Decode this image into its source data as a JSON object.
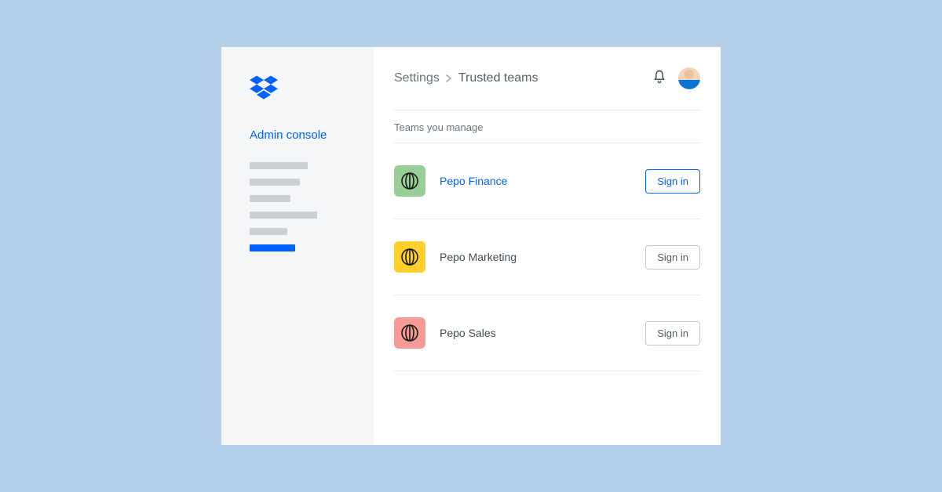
{
  "sidebar": {
    "title": "Admin console"
  },
  "breadcrumb": {
    "parent": "Settings",
    "current": "Trusted teams"
  },
  "section": {
    "title": "Teams you manage"
  },
  "teams": [
    {
      "name": "Pepo Finance",
      "icon_color": "green",
      "button_label": "Sign in",
      "active": true
    },
    {
      "name": "Pepo Marketing",
      "icon_color": "yellow",
      "button_label": "Sign in",
      "active": false
    },
    {
      "name": "Pepo Sales",
      "icon_color": "coral",
      "button_label": "Sign in",
      "active": false
    }
  ],
  "colors": {
    "accent": "#0061fe",
    "page_bg": "#b6d0ea"
  }
}
